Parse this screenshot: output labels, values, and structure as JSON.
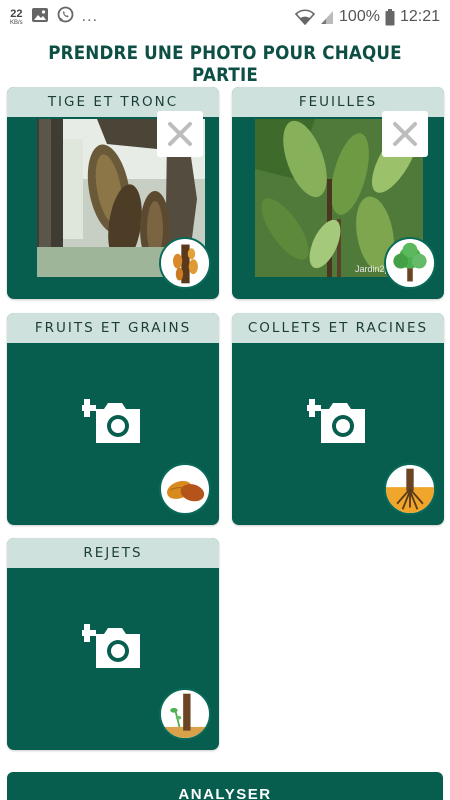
{
  "status_bar": {
    "net_speed_value": "22",
    "net_speed_unit": "KB/s",
    "overflow_indicator": "...",
    "battery": "100%",
    "time": "12:21"
  },
  "page_title": "PRENDRE UNE PHOTO POUR CHAQUE PARTIE",
  "cards": [
    {
      "label": "TIGE ET TRONC",
      "has_photo": true,
      "thumbnail": "cocoa-trunk-pods"
    },
    {
      "label": "FEUILLES",
      "has_photo": true,
      "thumbnail": "tree"
    },
    {
      "label": "FRUITS ET GRAINS",
      "has_photo": false,
      "thumbnail": "cocoa-pods"
    },
    {
      "label": "COLLETS ET RACINES",
      "has_photo": false,
      "thumbnail": "roots"
    },
    {
      "label": "REJETS",
      "has_photo": false,
      "thumbnail": "sucker-shoots"
    }
  ],
  "photos": [
    {
      "watermark": ""
    },
    {
      "watermark": "Jardin2pl"
    }
  ],
  "analyse_button": "ANALYSER",
  "colors": {
    "primary": "#075e4f",
    "header": "#cfe1dd",
    "title": "#0d4f45"
  }
}
